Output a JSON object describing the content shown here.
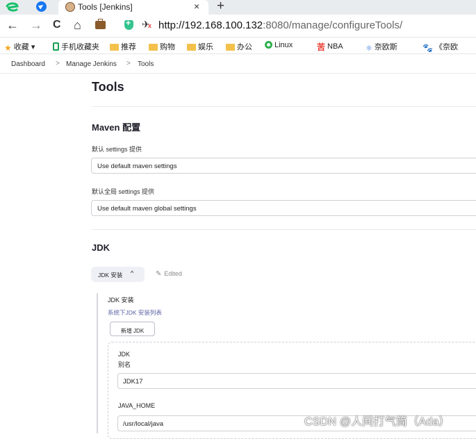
{
  "browser": {
    "tab_title": "Tools [Jenkins]",
    "tab_close": "×",
    "new_tab": "+",
    "nav": {
      "back": "←",
      "forward": "→",
      "reload": "C",
      "home": "⌂"
    },
    "url_host": "http://192.168.100.132",
    "url_path": ":8080/manage/configureTools/",
    "bookmarks": [
      {
        "label": "收藏",
        "icon": "star-icon",
        "dropdown": "▾"
      },
      {
        "label": "手机收藏夹",
        "icon": "phone-icon"
      },
      {
        "label": "推荐",
        "icon": "folder-icon"
      },
      {
        "label": "购物",
        "icon": "folder-icon"
      },
      {
        "label": "娱乐",
        "icon": "folder-icon"
      },
      {
        "label": "办公",
        "icon": "folder-icon"
      },
      {
        "label": "Linux",
        "icon": "ring-icon"
      },
      {
        "label": "NBA",
        "icon": "k-icon"
      },
      {
        "label": "奈欧斯",
        "icon": "s-icon"
      },
      {
        "label": "《奈欧",
        "icon": "paw-icon"
      }
    ]
  },
  "breadcrumb": {
    "items": [
      "Dashboard",
      "Manage Jenkins",
      "Tools"
    ],
    "separator": ">"
  },
  "page": {
    "title": "Tools",
    "maven": {
      "title": "Maven 配置",
      "settings_label": "默认 settings 提供",
      "settings_value": "Use default maven settings",
      "global_label": "默认全局 settings 提供",
      "global_value": "Use default maven global settings"
    },
    "jdk": {
      "title": "JDK",
      "toggle_label": "JDK 安装",
      "toggle_chevron": "^",
      "edited_icon": "✎",
      "edited_label": "Edited",
      "install_title": "JDK 安装",
      "install_desc": "系统下JDK 安装列表",
      "add_button": "新增 JDK",
      "card_title": "JDK",
      "alias_label": "别名",
      "alias_value": "JDK17",
      "home_label": "JAVA_HOME",
      "home_value": "/usr/local/java"
    }
  },
  "watermark": "CSDN @人间打气筒（Ada）",
  "colors": {
    "accent": "#1877f2",
    "link": "#5b62a6",
    "border": "#cfcfd6"
  }
}
